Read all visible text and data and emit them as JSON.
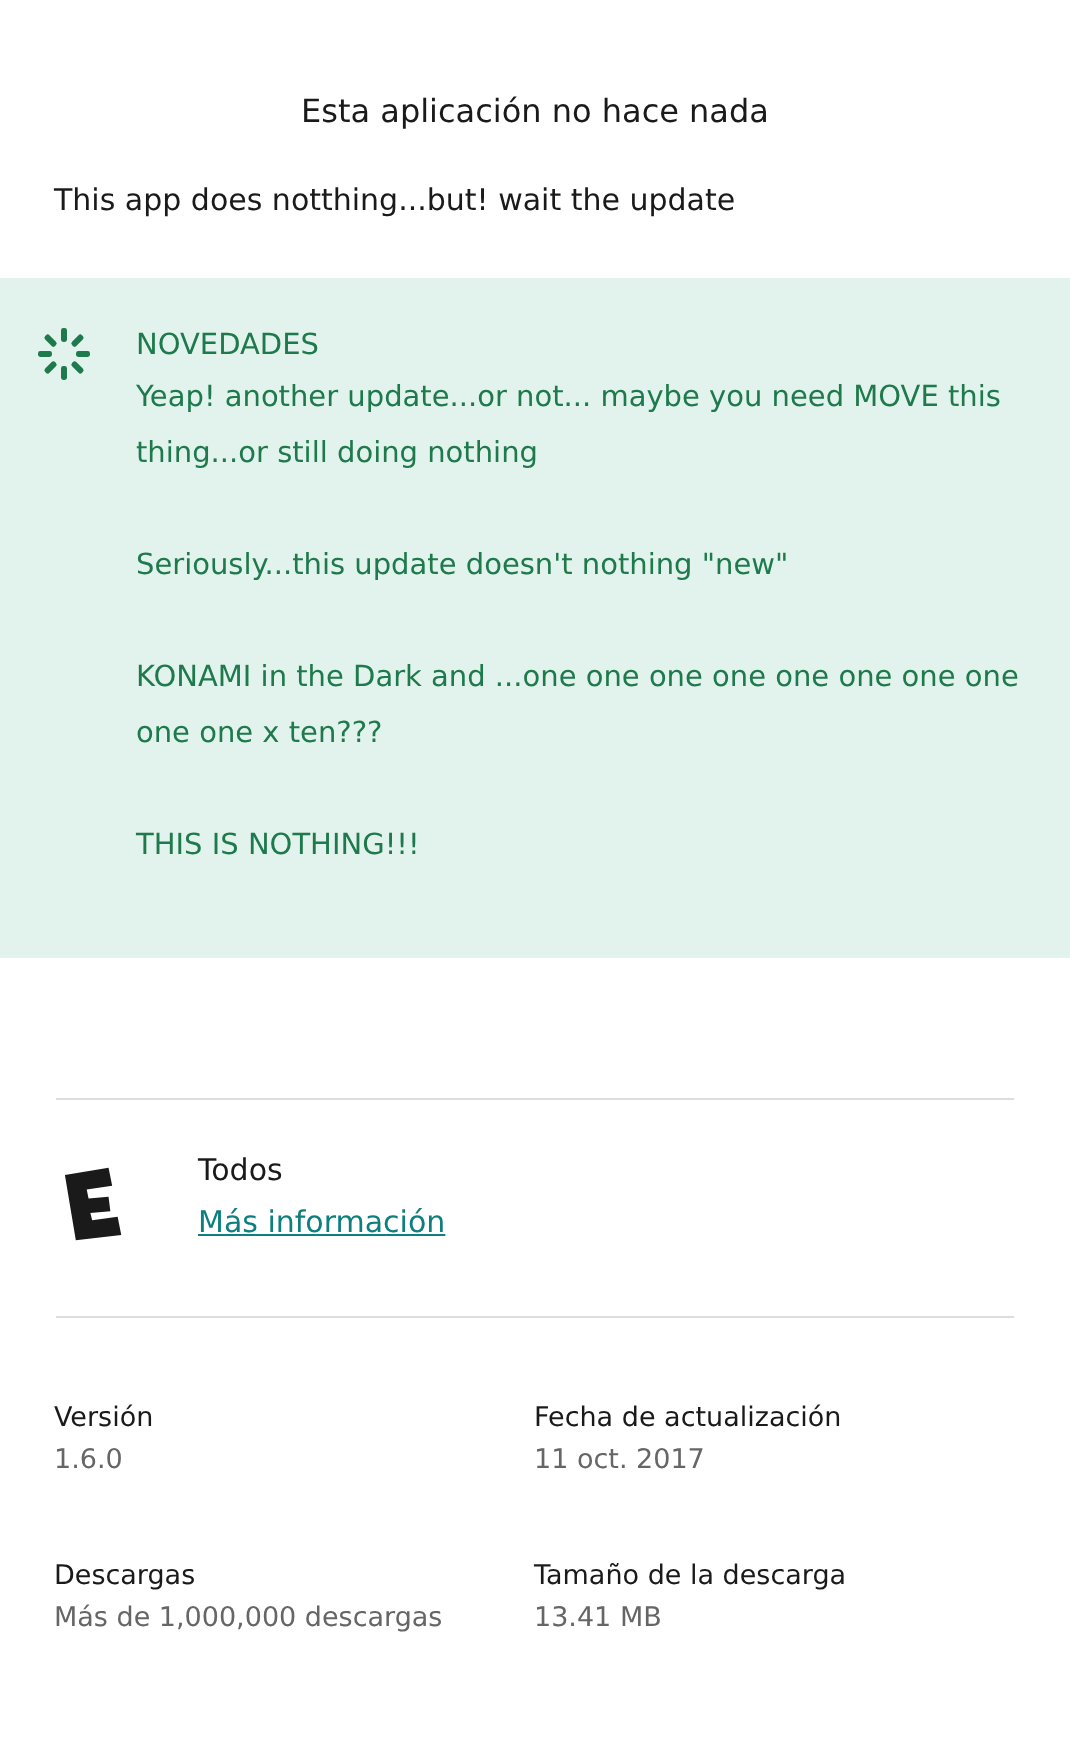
{
  "title": "Esta aplicación no hace nada",
  "description": "This app does notthing...but! wait the update",
  "whats_new": {
    "heading": "NOVEDADES",
    "paragraphs": [
      "Yeap! another update...or not... maybe you need MOVE this thing...or still doing nothing",
      "Seriously...this update doesn't nothing \"new\"",
      "KONAMI in the Dark and ...one one one one one one one one one one x ten???",
      "THIS IS NOTHING!!!"
    ]
  },
  "rating": {
    "label": "Todos",
    "link": "Más información"
  },
  "info": [
    {
      "label": "Versión",
      "value": "1.6.0"
    },
    {
      "label": "Fecha de actualización",
      "value": "11 oct. 2017"
    },
    {
      "label": "Descargas",
      "value": "Más de 1,000,000 descargas"
    },
    {
      "label": "Tamaño de la descarga",
      "value": "13.41 MB"
    }
  ]
}
